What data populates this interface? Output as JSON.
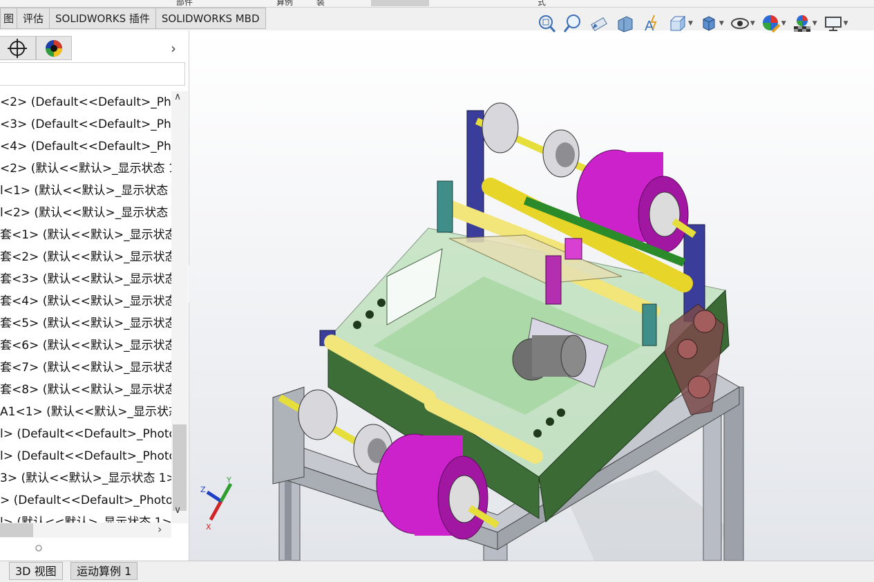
{
  "ribbon_fragments": [
    "部件",
    "算例",
    "装",
    "式"
  ],
  "command_tabs": [
    {
      "label": "图"
    },
    {
      "label": "评估"
    },
    {
      "label": "SOLIDWORKS 插件"
    },
    {
      "label": "SOLIDWORKS MBD"
    }
  ],
  "panel": {
    "tabs": [
      "feature-manager",
      "configuration-target",
      "display-manager"
    ],
    "filter_value": "",
    "tree_items": [
      "<2> (Default<<Default>_Pho",
      "<3> (Default<<Default>_Pho",
      "<4> (Default<<Default>_Pho",
      "<2> (默认<<默认>_显示状态 1",
      "l<1> (默认<<默认>_显示状态",
      "l<2> (默认<<默认>_显示状态",
      "套<1> (默认<<默认>_显示状态",
      "套<2> (默认<<默认>_显示状态",
      "套<3> (默认<<默认>_显示状态",
      "套<4> (默认<<默认>_显示状态",
      "套<5> (默认<<默认>_显示状态",
      "套<6> (默认<<默认>_显示状态",
      "套<7> (默认<<默认>_显示状态",
      "套<8> (默认<<默认>_显示状态",
      "A1<1> (默认<<默认>_显示状态",
      "l> (Default<<Default>_Photo",
      "l> (Default<<Default>_Photo",
      "3> (默认<<默认>_显示状态 1>",
      "> (Default<<Default>_Photo",
      "l> (默认<<默认>_显示状态 1>"
    ]
  },
  "hud_icons": [
    {
      "name": "zoom-to-fit-icon"
    },
    {
      "name": "zoom-to-area-icon"
    },
    {
      "name": "previous-view-icon"
    },
    {
      "name": "section-view-icon"
    },
    {
      "name": "dynamic-annotation-view-icon"
    },
    {
      "name": "view-orientation-icon"
    },
    {
      "name": "display-style-icon"
    },
    {
      "name": "hide-show-items-icon"
    },
    {
      "name": "edit-appearance-icon"
    },
    {
      "name": "apply-scene-icon"
    },
    {
      "name": "view-settings-icon"
    }
  ],
  "triad": {
    "x": "X",
    "y": "Y",
    "z": "Z"
  },
  "bottom_tabs": [
    {
      "label": "3D 视图"
    },
    {
      "label": "运动算例 1"
    }
  ],
  "colors": {
    "magenta_pulley": "#cc22cc",
    "yellow_roller": "#f2e67a",
    "green_frame": "#3a6b35",
    "glass": "#a7dca0",
    "bracket_blue": "#3a3d9a"
  }
}
